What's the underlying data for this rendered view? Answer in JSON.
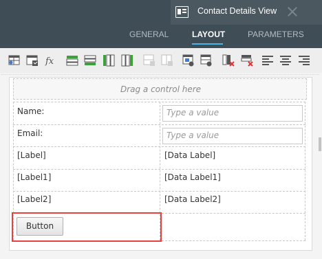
{
  "window": {
    "title": "Contact Details View"
  },
  "tabs": [
    {
      "label": "GENERAL",
      "active": false
    },
    {
      "label": "LAYOUT",
      "active": true
    },
    {
      "label": "PARAMETERS",
      "active": false
    }
  ],
  "toolbar": {
    "tools": [
      "insert-table-icon",
      "insert-control-icon",
      "formula-icon",
      "insert-row-above-icon",
      "insert-row-below-icon",
      "insert-column-left-icon",
      "insert-column-right-icon",
      "merge-cells-icon",
      "split-cells-icon",
      "cell-properties-icon",
      "table-properties-icon",
      "delete-column-icon",
      "delete-row-icon",
      "align-left-icon",
      "align-center-icon",
      "align-right-icon"
    ]
  },
  "canvas": {
    "drop_zone_text": "Drag a control here",
    "rows": [
      {
        "label": "Name:",
        "input_placeholder": "Type a value"
      },
      {
        "label": "Email:",
        "input_placeholder": "Type a value"
      },
      {
        "label": "[Label]",
        "value": "[Data Label]"
      },
      {
        "label": "[Label1]",
        "value": "[Data Label1]"
      },
      {
        "label": "[Label2]",
        "value": "[Data Label2]"
      }
    ],
    "button_label": "Button"
  },
  "colors": {
    "header_bg": "#3f4d57",
    "active_tab_underline": "#4ab4e6",
    "highlight_border": "#e83f3f"
  }
}
